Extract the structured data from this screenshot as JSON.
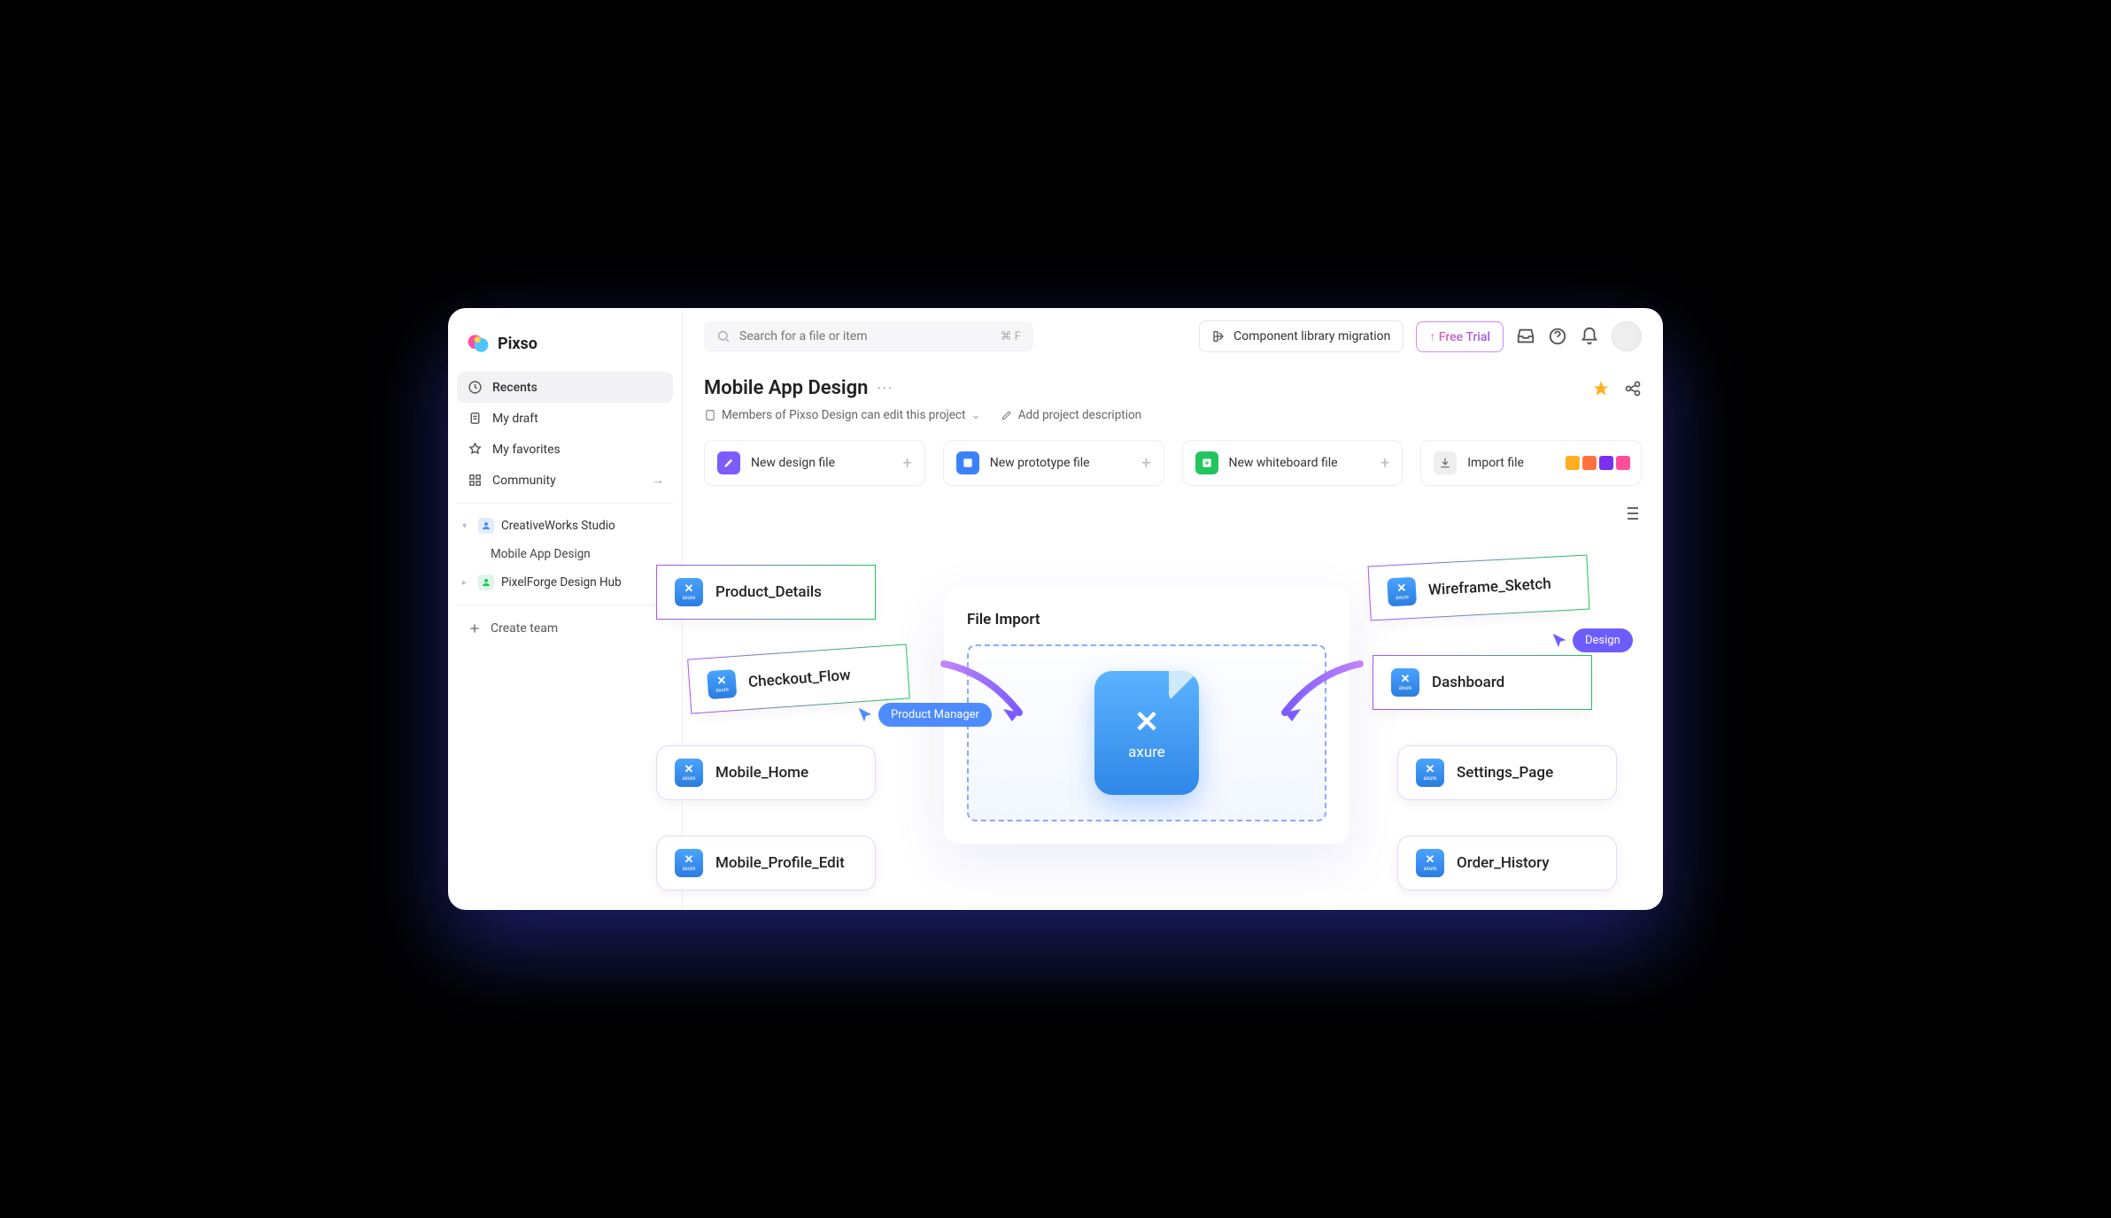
{
  "brand": "Pixso",
  "search": {
    "placeholder": "Search for a file or item",
    "shortcut": "⌘ F"
  },
  "header": {
    "component_migration": "Component library migration",
    "free_trial": "↑ Free Trial"
  },
  "sidebar": {
    "recents": "Recents",
    "my_draft": "My draft",
    "my_favorites": "My favorites",
    "community": "Community",
    "teams": [
      {
        "name": "CreativeWorks Studio",
        "children": [
          "Mobile App Design"
        ]
      },
      {
        "name": "PixelForge Design Hub",
        "children": []
      }
    ],
    "create_team": "Create team"
  },
  "project": {
    "title": "Mobile App Design",
    "members_note": "Members of Pixso Design can edit this project",
    "add_description": "Add project description"
  },
  "new_cards": {
    "design": "New design file",
    "prototype": "New prototype file",
    "whiteboard": "New whiteboard file",
    "import": "Import file"
  },
  "panel": {
    "title": "File Import"
  },
  "chips": {
    "left": [
      "Product_Details",
      "Checkout_Flow",
      "Mobile_Home",
      "Mobile_Profile_Edit"
    ],
    "right": [
      "Wireframe_Sketch",
      "Dashboard",
      "Settings_Page",
      "Order_History"
    ]
  },
  "cursors": {
    "pm": "Product Manager",
    "design": "Design"
  },
  "axure_label": "axure"
}
